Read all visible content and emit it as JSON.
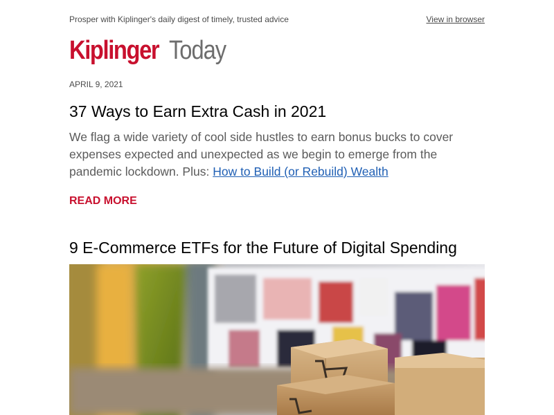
{
  "preheader": {
    "tagline": "Prosper with Kiplinger's daily digest of timely, trusted advice",
    "view_in_browser": "View in browser"
  },
  "logo": {
    "brand": "Kiplinger",
    "product": "Today"
  },
  "date": "APRIL 9, 2021",
  "articles": [
    {
      "title": "37 Ways to Earn Extra Cash in 2021",
      "summary": "We flag a wide variety of cool side hustles to earn bonus bucks to cover expenses expected and unexpected as we begin to emerge from the pandemic lockdown. Plus: ",
      "link_text": "How to Build (or Rebuild) Wealth",
      "cta": "READ MORE"
    },
    {
      "title": "9 E-Commerce ETFs for the Future of Digital Spending"
    }
  ],
  "colors": {
    "brand_red": "#c8102e",
    "link_blue": "#1f5fb4",
    "body_gray": "#5a5a5a"
  },
  "images": {
    "hero": "shopping-cart-boxes-on-laptop-photo"
  }
}
